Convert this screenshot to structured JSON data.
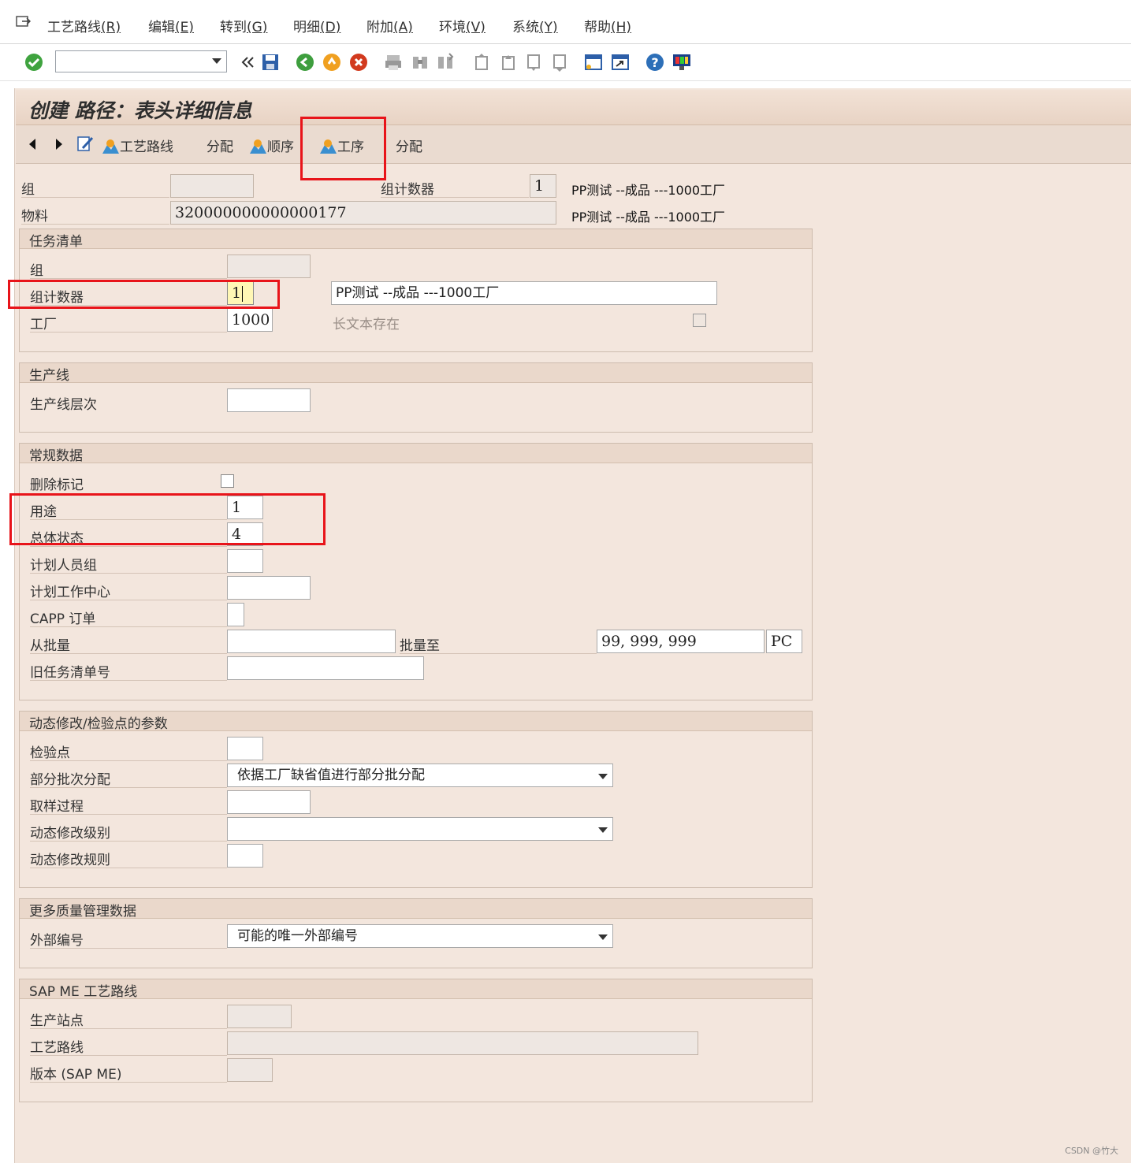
{
  "menu": {
    "items": [
      {
        "label": "工艺路线",
        "key": "(R)"
      },
      {
        "label": "编辑",
        "key": "(E)"
      },
      {
        "label": "转到",
        "key": "(G)"
      },
      {
        "label": "明细",
        "key": "(D)"
      },
      {
        "label": "附加",
        "key": "(A)"
      },
      {
        "label": "环境",
        "key": "(V)"
      },
      {
        "label": "系统",
        "key": "(Y)"
      },
      {
        "label": "帮助",
        "key": "(H)"
      }
    ]
  },
  "page": {
    "title": "创建 路径：表头详细信息"
  },
  "app_toolbar": {
    "routing": "工艺路线",
    "assign1": "分配",
    "sequence": "顺序",
    "operation": "工序",
    "assign2": "分配"
  },
  "header": {
    "group_label": "组",
    "group_value": "",
    "counter_label": "组计数器",
    "counter_value": "1",
    "counter_desc": "PP测试 --成品 ---1000工厂",
    "material_label": "物料",
    "material_value": "320000000000000177",
    "material_desc": "PP测试 --成品 ---1000工厂"
  },
  "task_list": {
    "title": "任务清单",
    "group_label": "组",
    "group_value": "",
    "counter_label": "组计数器",
    "counter_value": "1",
    "desc_value": "PP测试 --成品 ---1000工厂",
    "plant_label": "工厂",
    "plant_value": "1000",
    "longtext_label": "长文本存在"
  },
  "line": {
    "title": "生产线",
    "hierarchy_label": "生产线层次",
    "hierarchy_value": ""
  },
  "general": {
    "title": "常规数据",
    "delete_label": "删除标记",
    "usage_label": "用途",
    "usage_value": "1",
    "status_label": "总体状态",
    "status_value": "4",
    "planner_label": "计划人员组",
    "planner_value": "",
    "workcenter_label": "计划工作中心",
    "workcenter_value": "",
    "capp_label": "CAPP 订单",
    "capp_value": "",
    "lot_from_label": "从批量",
    "lot_from_value": "",
    "lot_to_label": "批量至",
    "lot_to_value": "99, 999, 999",
    "unit_value": "PC",
    "old_list_label": "旧任务清单号",
    "old_list_value": ""
  },
  "dynamic": {
    "title": "动态修改/检验点的参数",
    "inspection_label": "检验点",
    "partial_label": "部分批次分配",
    "partial_value": "依据工厂缺省值进行部分批分配",
    "sampling_label": "取样过程",
    "modlevel_label": "动态修改级别",
    "modlevel_value": "",
    "modrule_label": "动态修改规则"
  },
  "quality": {
    "title": "更多质量管理数据",
    "extnum_label": "外部编号",
    "extnum_value": "可能的唯一外部编号"
  },
  "sapme": {
    "title": "SAP ME 工艺路线",
    "station_label": "生产站点",
    "routing_label": "工艺路线",
    "version_label": "版本 (SAP ME)"
  },
  "watermark": "CSDN @竹大",
  "colors": {
    "background": "#f3e6dd",
    "highlight": "#e8141a",
    "field_focus": "#fff7b5"
  }
}
